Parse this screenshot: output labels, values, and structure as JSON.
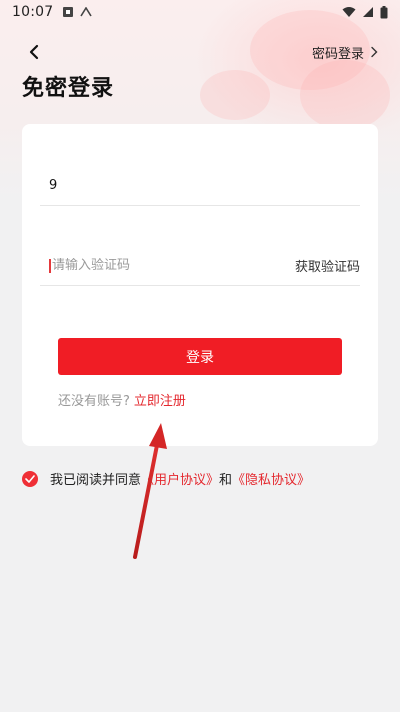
{
  "status_bar": {
    "time": "10:07",
    "icons": [
      "notification-a-icon",
      "signal-icon",
      "wifi-icon",
      "cellular-icon",
      "battery-icon"
    ]
  },
  "header": {
    "back_icon": "chevron-left-icon",
    "switch_label": "密码登录",
    "switch_icon": "chevron-right-icon",
    "title": "免密登录"
  },
  "form": {
    "phone_value": "9",
    "code_placeholder": "请输入验证码",
    "get_code_label": "获取验证码",
    "login_label": "登录",
    "no_account_text": "还没有账号?",
    "register_label": "立即注册"
  },
  "agreement": {
    "checked": true,
    "prefix": "我已阅读并同意",
    "user_agreement": "《用户协议》",
    "and_text": "和",
    "privacy_policy": "《隐私协议》"
  },
  "colors": {
    "accent": "#f01d25",
    "link": "#e4282e",
    "background": "#f1f1f2",
    "card": "#ffffff",
    "arrow": "#d42626"
  }
}
